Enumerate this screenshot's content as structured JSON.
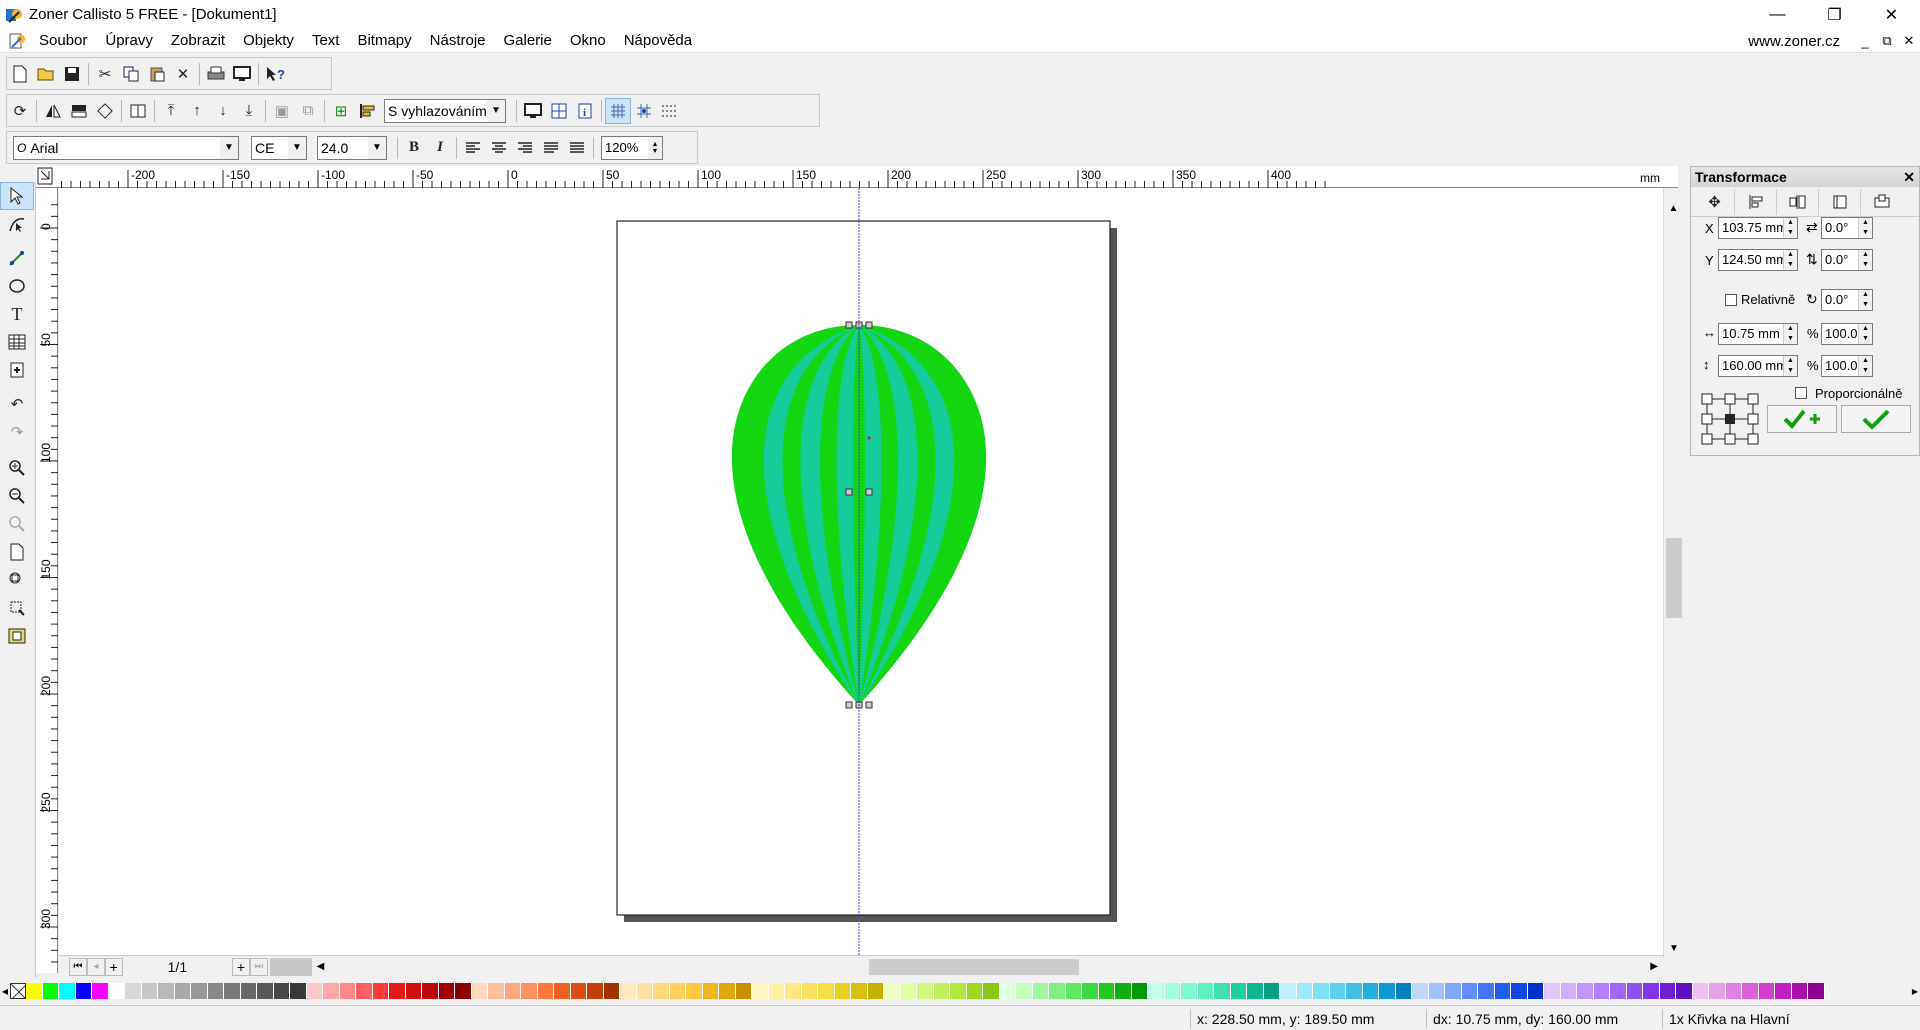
{
  "window": {
    "title": "Zoner Callisto 5 FREE - [Dokument1]",
    "controls": [
      "—",
      "❐",
      "✕"
    ]
  },
  "menu": {
    "items": [
      "Soubor",
      "Úpravy",
      "Zobrazit",
      "Objekty",
      "Text",
      "Bitmapy",
      "Nástroje",
      "Galerie",
      "Okno",
      "Nápověda"
    ],
    "site": "www.zoner.cz",
    "mdi_controls": [
      "_",
      "⧉",
      "✕"
    ]
  },
  "toolbar2": {
    "smoothing": "S vyhlazováním"
  },
  "toolbar3": {
    "font": "Arial",
    "charset": "CE",
    "size": "24.0",
    "bold": "B",
    "italic": "I",
    "spacing": "120%"
  },
  "ruler": {
    "unit": "mm",
    "h_labels": [
      "-200",
      "-150",
      "-100",
      "-50",
      "0",
      "50",
      "100",
      "150",
      "200",
      "250",
      "300",
      "350",
      "400"
    ],
    "v_labels": [
      "0",
      "50",
      "100",
      "150",
      "200",
      "250",
      "300"
    ]
  },
  "pages": {
    "counter": "1/1"
  },
  "transform_panel": {
    "title": "Transformace",
    "x_label": "X",
    "x_value": "103.75 mm",
    "y_label": "Y",
    "y_value": "124.50 mm",
    "skew_h": "0.0°",
    "skew_v": "0.0°",
    "rotate": "0.0°",
    "relative_label": "Relativně",
    "width_value": "10.75 mm",
    "height_value": "160.00 mm",
    "width_pct": "100.0",
    "height_pct": "100.0",
    "pct_sign": "%",
    "proportional_label": "Proporcionálně"
  },
  "status": {
    "cursor": "x: 228.50 mm, y: 189.50 mm",
    "delta": "dx: 10.75 mm, dy: 160.00 mm",
    "selection": "1x Křivka na Hlavní"
  },
  "colors": {
    "balloon_green": "#12d612",
    "balloon_teal": "#14cc9a",
    "guide": "#3040c8",
    "palette": [
      "#ffff00",
      "#00ff00",
      "#00ffff",
      "#0000ff",
      "#ff00ff",
      "#ffffff",
      "#d8d8d8",
      "#c8c8c8",
      "#b8b8b8",
      "#a8a8a8",
      "#989898",
      "#888888",
      "#787878",
      "#686868",
      "#585858",
      "#484848",
      "#383838",
      "#ffc8c8",
      "#ffa8a8",
      "#ff8888",
      "#ff6060",
      "#ff3838",
      "#e81818",
      "#d01010",
      "#b80808",
      "#a00000",
      "#880000",
      "#ffd8c0",
      "#ffc0a0",
      "#ffa880",
      "#ff9060",
      "#ff7840",
      "#f06020",
      "#d85010",
      "#c04008",
      "#a03000",
      "#ffe8c0",
      "#ffe0a0",
      "#ffd880",
      "#ffd060",
      "#ffc840",
      "#f0b820",
      "#e0a810",
      "#c89000",
      "#fff8c0",
      "#fff0a0",
      "#ffe880",
      "#ffe060",
      "#f8e040",
      "#e8d020",
      "#d8c010",
      "#c8b000",
      "#f0ffc0",
      "#e0ffa0",
      "#d0f880",
      "#c0f060",
      "#b0e840",
      "#a0d820",
      "#88c810",
      "#e0ffe0",
      "#c0ffc0",
      "#a0f8a0",
      "#80f080",
      "#60e860",
      "#40d840",
      "#20c820",
      "#10b010",
      "#009800",
      "#c0fff0",
      "#a0ffe0",
      "#80f8d0",
      "#60f0c0",
      "#40e0b0",
      "#20d0a0",
      "#10b890",
      "#00a080",
      "#c0f0ff",
      "#a0e8ff",
      "#80e0f8",
      "#60d0f0",
      "#40c0e8",
      "#20b0e0",
      "#1098d0",
      "#0080c0",
      "#c0d8ff",
      "#a0c0ff",
      "#80a8ff",
      "#6090ff",
      "#4078f8",
      "#2060f0",
      "#1048e0",
      "#0030c8",
      "#e0c8ff",
      "#d0b0ff",
      "#c098ff",
      "#b080ff",
      "#a068f8",
      "#9050f0",
      "#8038e0",
      "#7020d0",
      "#6010c0",
      "#f0c0f0",
      "#e8a0e8",
      "#e080e0",
      "#d860d8",
      "#d040d0",
      "#c020c0",
      "#a810a8",
      "#900090"
    ]
  }
}
